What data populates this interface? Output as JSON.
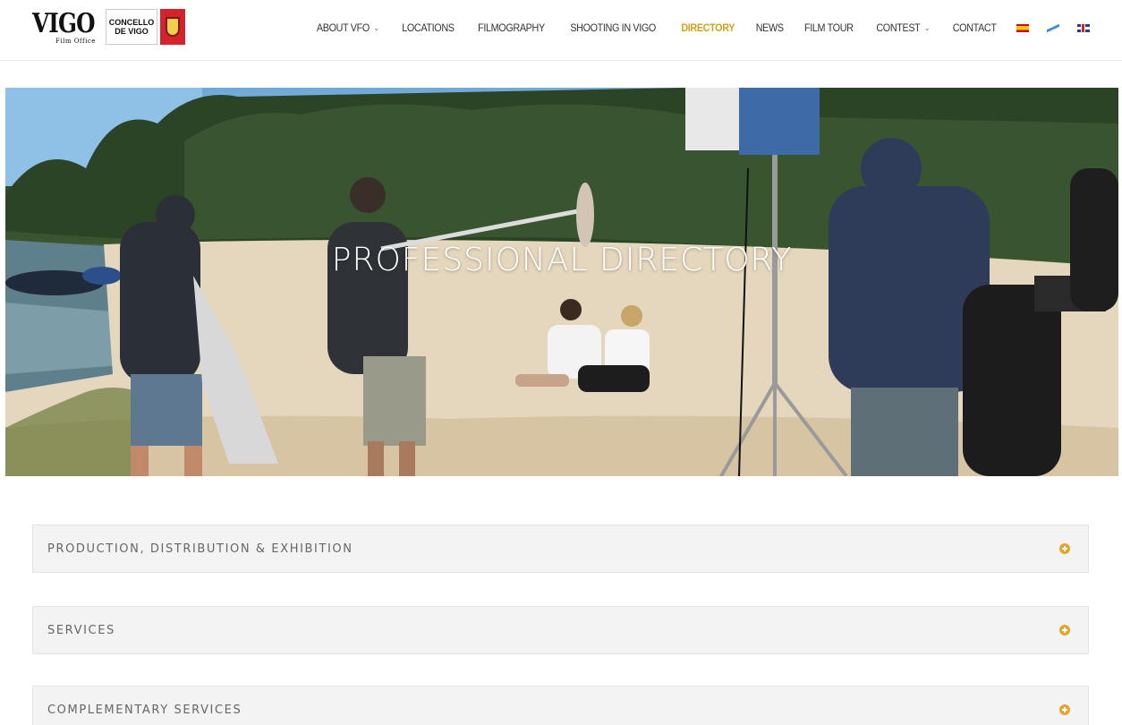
{
  "brand": {
    "logo_word": "VIGO",
    "logo_sub": "Film Office",
    "concello_line1": "CONCELLO",
    "concello_line2": "DE VIGO"
  },
  "nav": {
    "items": [
      {
        "label": "ABOUT VFO",
        "has_dropdown": true
      },
      {
        "label": "LOCATIONS",
        "has_dropdown": false
      },
      {
        "label": "FILMOGRAPHY",
        "has_dropdown": false
      },
      {
        "label": "SHOOTING IN VIGO",
        "has_dropdown": false
      },
      {
        "label": "DIRECTORY",
        "has_dropdown": false,
        "active": true
      },
      {
        "label": "NEWS",
        "has_dropdown": false
      },
      {
        "label": "FILM TOUR",
        "has_dropdown": false
      },
      {
        "label": "CONTEST",
        "has_dropdown": true
      },
      {
        "label": "CONTACT",
        "has_dropdown": false
      }
    ],
    "languages": [
      "es",
      "gl",
      "en"
    ]
  },
  "hero": {
    "title": "PROFESSIONAL DIRECTORY"
  },
  "accordions": [
    {
      "label": "PRODUCTION, DISTRIBUTION & EXHIBITION"
    },
    {
      "label": "SERVICES"
    },
    {
      "label": "COMPLEMENTARY SERVICES"
    }
  ],
  "colors": {
    "accent": "#e3a52a",
    "active_nav": "#d4a21a",
    "panel_bg": "#f3f3f3"
  }
}
